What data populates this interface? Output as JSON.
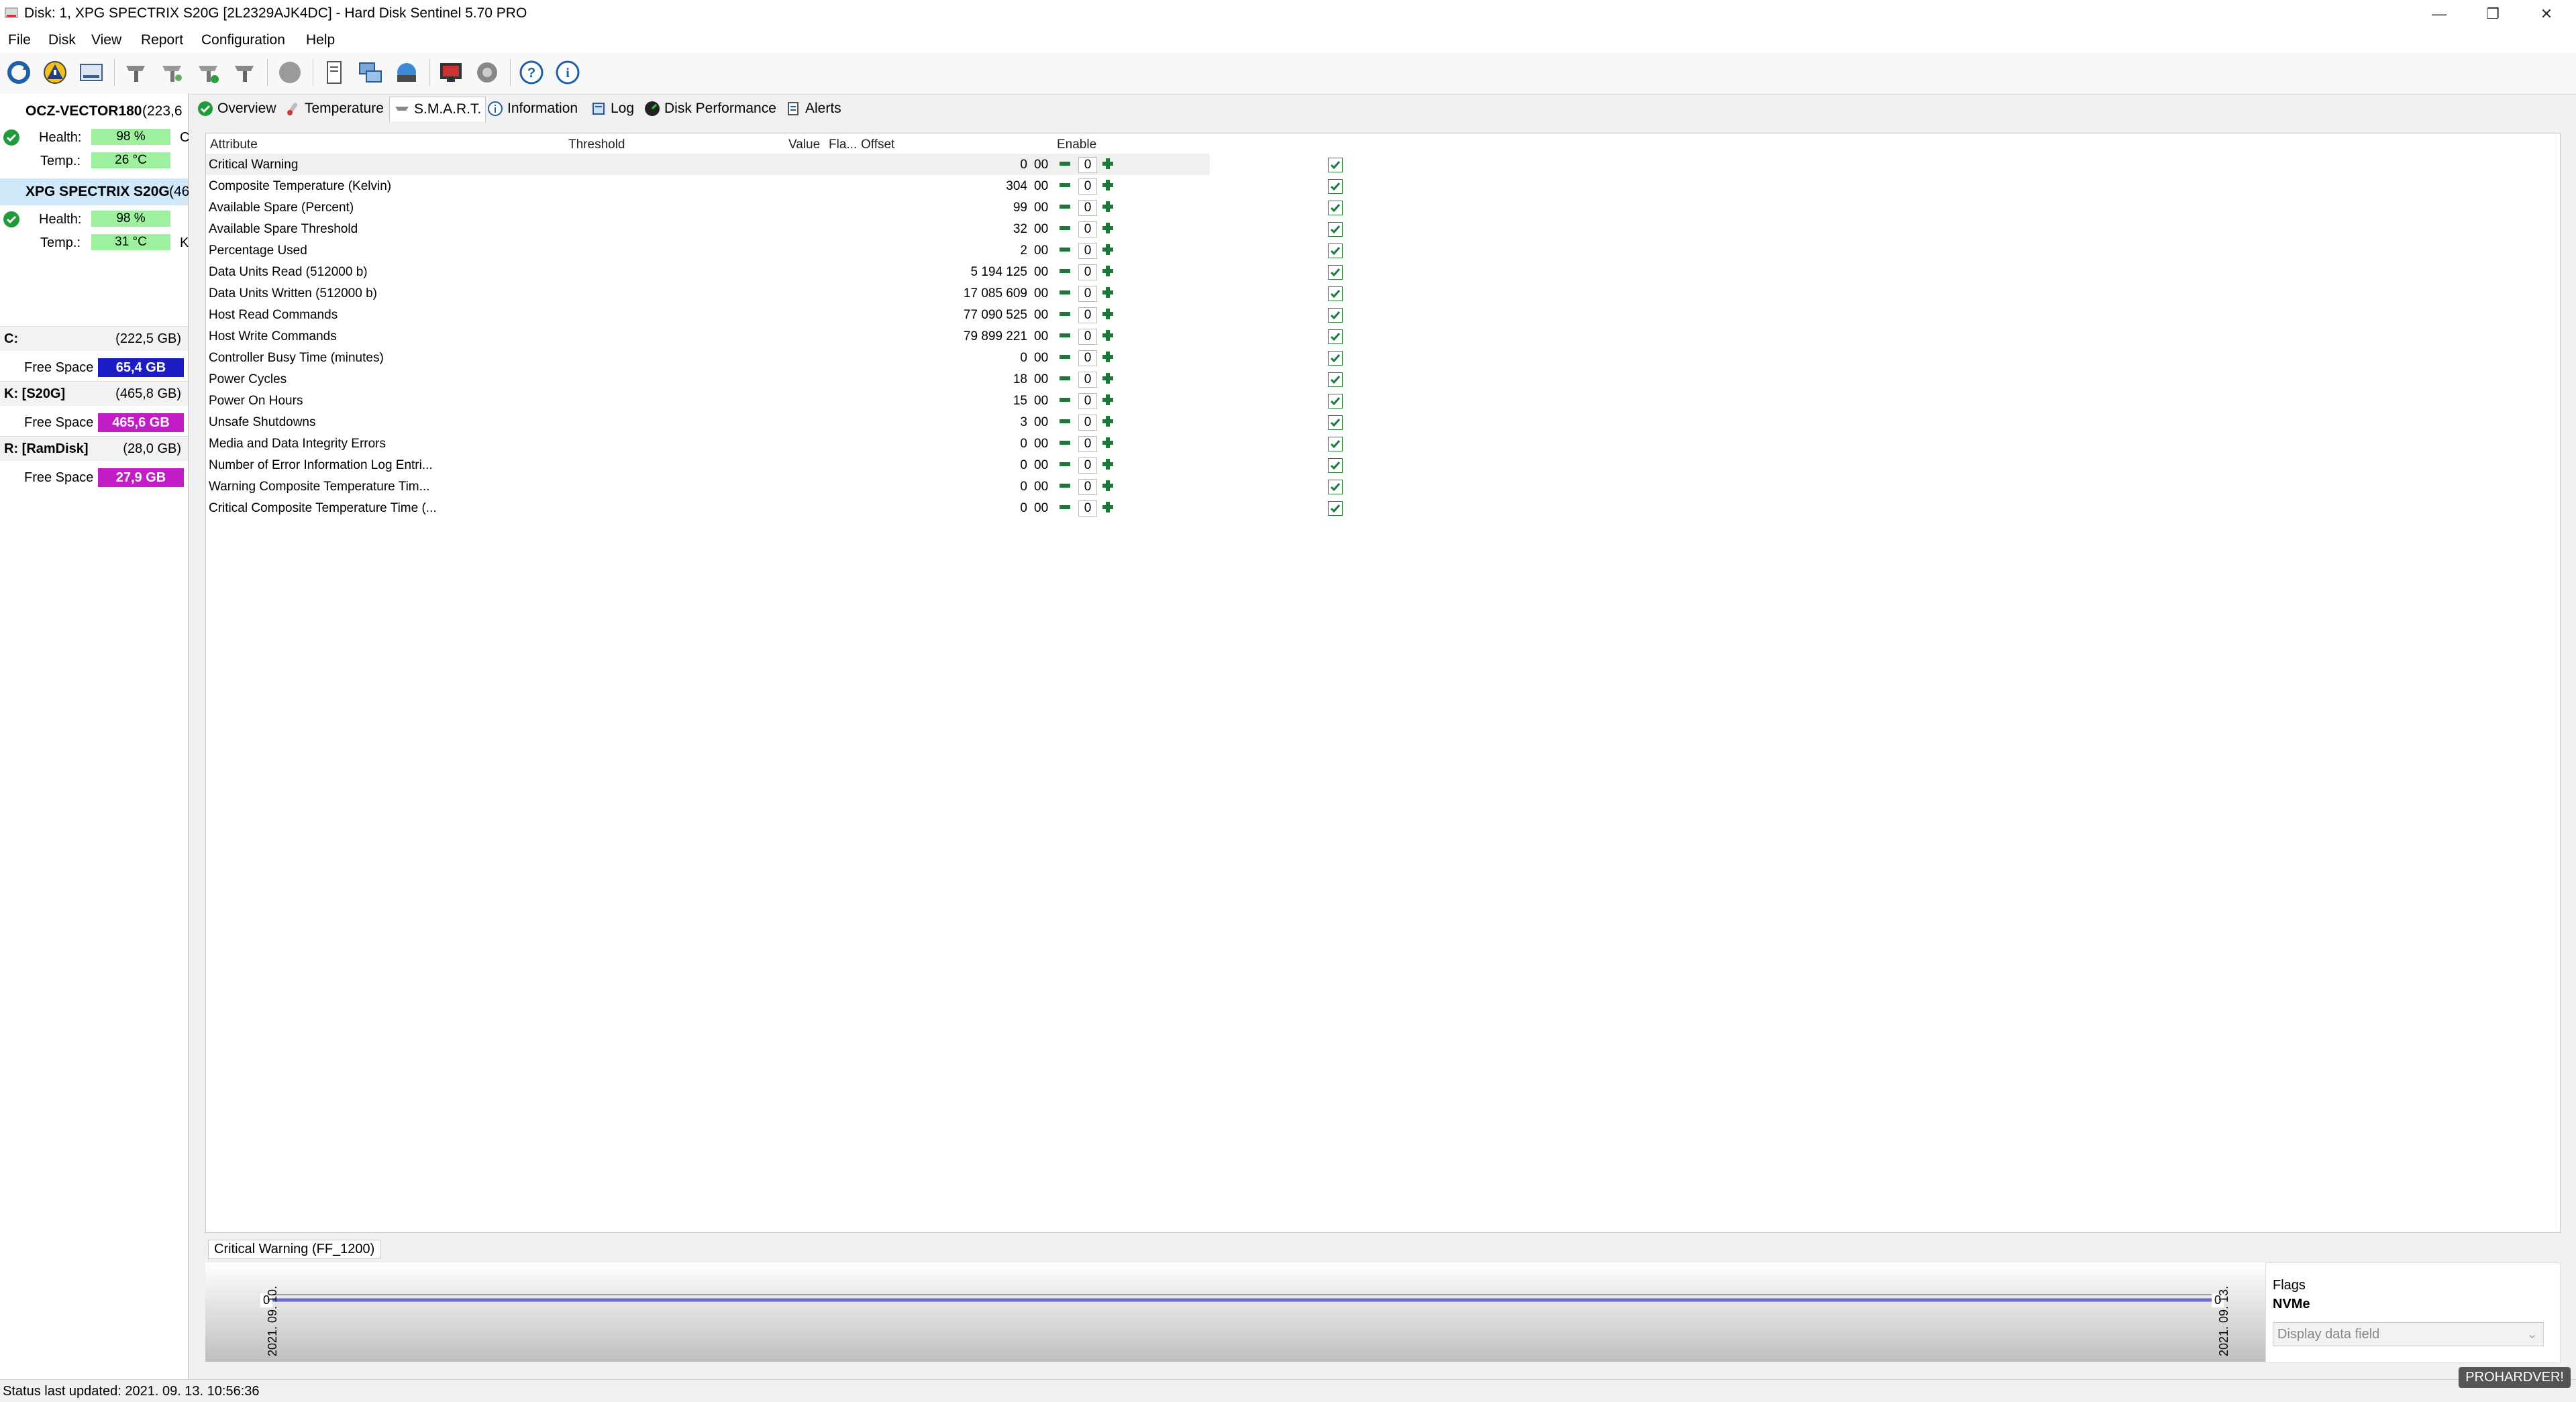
{
  "window": {
    "title": "Disk: 1, XPG SPECTRIX S20G [2L2329AJK4DC]  -  Hard Disk Sentinel 5.70 PRO"
  },
  "menu": [
    "File",
    "Disk",
    "View",
    "Report",
    "Configuration",
    "Help"
  ],
  "toolbar": {
    "icons": [
      "refresh-icon",
      "health-warning-icon",
      "disk-drive-icon",
      "clean-disk-icon",
      "disk-tools-icon",
      "disk-check-icon",
      "disk-info-icon",
      "blank-icon",
      "report-icon",
      "network-icon",
      "remote-icon",
      "settings-monitor-icon",
      "dial-icon",
      "help-icon",
      "info-icon"
    ]
  },
  "disks": [
    {
      "name": "OCZ-VECTOR180",
      "size": "(223,6",
      "health": "98 %",
      "health_value": 98,
      "temp": "26 °C",
      "extra": "C"
    },
    {
      "name": "XPG SPECTRIX S20G",
      "size": "(46",
      "health": "98 %",
      "health_value": 98,
      "temp": "31 °C",
      "extra": "K"
    }
  ],
  "labels": {
    "health": "Health:",
    "temp": "Temp.:",
    "free_space": "Free Space"
  },
  "volumes": [
    {
      "name": "C:",
      "size": "(222,5 GB)",
      "free": "65,4 GB",
      "color": "#1c1cc4"
    },
    {
      "name": "K: [S20G]",
      "size": "(465,8 GB)",
      "free": "465,6 GB",
      "color": "#c21cc6"
    },
    {
      "name": "R: [RamDisk]",
      "size": "(28,0 GB)",
      "free": "27,9 GB",
      "color": "#c21cc6"
    }
  ],
  "tabs": [
    "Overview",
    "Temperature",
    "S.M.A.R.T.",
    "Information",
    "Log",
    "Disk Performance",
    "Alerts"
  ],
  "smart": {
    "columns": {
      "attribute": "Attribute",
      "threshold": "Threshold",
      "value": "Value",
      "flags": "Fla...",
      "offset": "Offset",
      "enable": "Enable"
    },
    "rows": [
      {
        "attr": "Critical Warning",
        "value": "0",
        "flag": "00",
        "offset": "0"
      },
      {
        "attr": "Composite Temperature (Kelvin)",
        "value": "304",
        "flag": "00",
        "offset": "0"
      },
      {
        "attr": "Available Spare (Percent)",
        "value": "99",
        "flag": "00",
        "offset": "0"
      },
      {
        "attr": "Available Spare Threshold",
        "value": "32",
        "flag": "00",
        "offset": "0"
      },
      {
        "attr": "Percentage Used",
        "value": "2",
        "flag": "00",
        "offset": "0"
      },
      {
        "attr": "Data Units Read (512000 b)",
        "value": "5 194 125",
        "flag": "00",
        "offset": "0"
      },
      {
        "attr": "Data Units Written (512000 b)",
        "value": "17 085 609",
        "flag": "00",
        "offset": "0"
      },
      {
        "attr": "Host Read Commands",
        "value": "77 090 525",
        "flag": "00",
        "offset": "0"
      },
      {
        "attr": "Host Write Commands",
        "value": "79 899 221",
        "flag": "00",
        "offset": "0"
      },
      {
        "attr": "Controller Busy Time (minutes)",
        "value": "0",
        "flag": "00",
        "offset": "0"
      },
      {
        "attr": "Power Cycles",
        "value": "18",
        "flag": "00",
        "offset": "0"
      },
      {
        "attr": "Power On Hours",
        "value": "15",
        "flag": "00",
        "offset": "0"
      },
      {
        "attr": "Unsafe Shutdowns",
        "value": "3",
        "flag": "00",
        "offset": "0"
      },
      {
        "attr": "Media and Data Integrity Errors",
        "value": "0",
        "flag": "00",
        "offset": "0"
      },
      {
        "attr": "Number of Error Information Log Entri...",
        "value": "0",
        "flag": "00",
        "offset": "0"
      },
      {
        "attr": "Warning Composite Temperature Tim...",
        "value": "0",
        "flag": "00",
        "offset": "0"
      },
      {
        "attr": "Critical Composite Temperature Time (...",
        "value": "0",
        "flag": "00",
        "offset": "0"
      }
    ]
  },
  "chart": {
    "title": "Critical Warning (FF_1200)",
    "start_value": "0",
    "end_value": "0",
    "start_date": "2021. 09. 10.",
    "end_date": "2021. 09. 13."
  },
  "flags_panel": {
    "label": "Flags",
    "value": "NVMe",
    "dropdown": "Display data field"
  },
  "status": "Status last updated: 2021. 09. 13. 10:56:36",
  "watermark": "PROHARDVER!"
}
